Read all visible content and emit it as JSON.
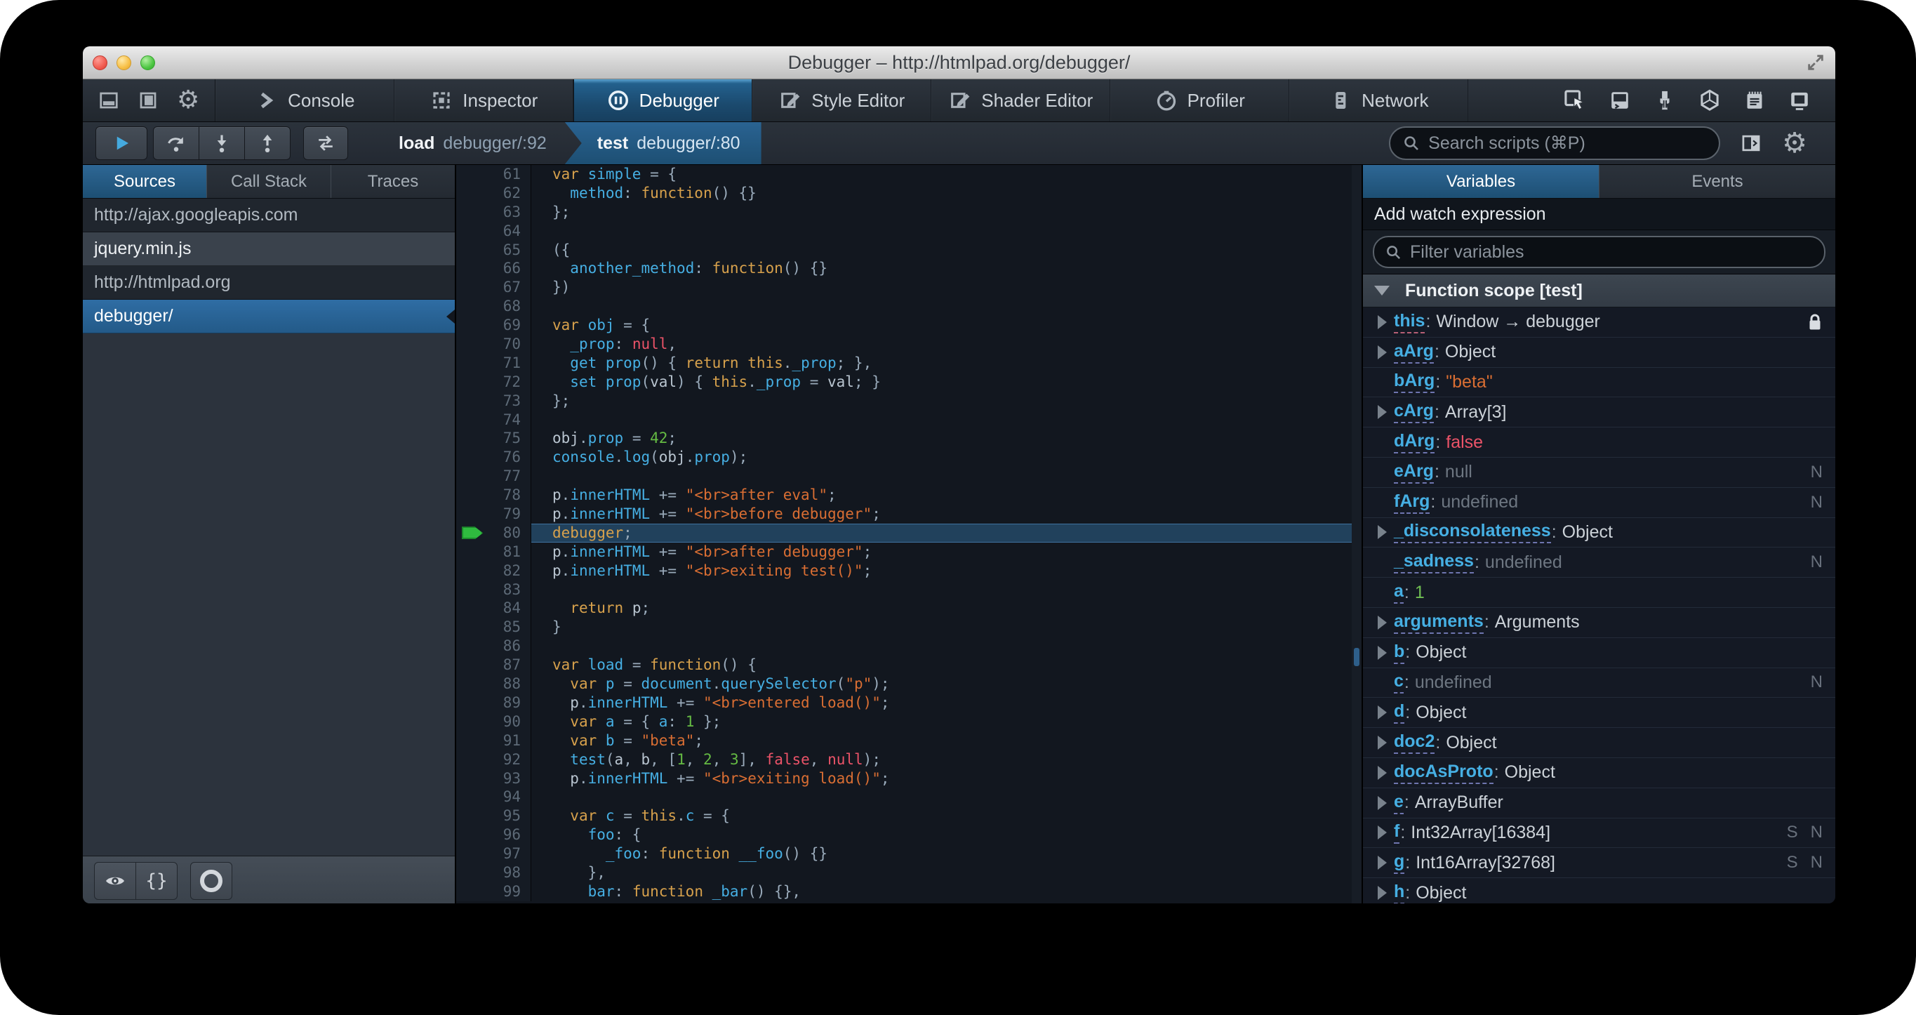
{
  "window": {
    "title": "Debugger – http://htmlpad.org/debugger/"
  },
  "toolbar": {
    "left_icons": [
      "dock-bottom-icon",
      "dock-side-icon",
      "options-gear-icon"
    ],
    "tabs": [
      {
        "label": "Console",
        "icon": "console",
        "active": false
      },
      {
        "label": "Inspector",
        "icon": "inspector",
        "active": false
      },
      {
        "label": "Debugger",
        "icon": "debugger",
        "active": true
      },
      {
        "label": "Style Editor",
        "icon": "style-editor",
        "active": false
      },
      {
        "label": "Shader Editor",
        "icon": "shader-editor",
        "active": false
      },
      {
        "label": "Profiler",
        "icon": "profiler",
        "active": false
      },
      {
        "label": "Network",
        "icon": "network",
        "active": false
      }
    ],
    "right_icons": [
      "pick-element-icon",
      "split-console-icon",
      "paintbrush-icon",
      "tilt-3d-icon",
      "scratchpad-icon",
      "responsive-mode-icon"
    ]
  },
  "debugbar": {
    "buttons": [
      "resume",
      "step-over",
      "step-in",
      "step-out"
    ],
    "trace_button": "trace",
    "breadcrumbs": [
      {
        "fn": "load",
        "loc": "debugger/:92",
        "active": false
      },
      {
        "fn": "test",
        "loc": "debugger/:80",
        "active": true
      }
    ],
    "search_placeholder": "Search scripts (⌘P)",
    "right_icons": [
      "toggle-panel-icon",
      "debugger-options-gear-icon"
    ]
  },
  "sources": {
    "tabs": [
      {
        "label": "Sources",
        "active": true
      },
      {
        "label": "Call Stack",
        "active": false
      },
      {
        "label": "Traces",
        "active": false
      }
    ],
    "items": [
      {
        "kind": "group",
        "label": "http://ajax.googleapis.com"
      },
      {
        "kind": "file",
        "label": "jquery.min.js",
        "selected": false
      },
      {
        "kind": "group",
        "label": "http://htmlpad.org"
      },
      {
        "kind": "file",
        "label": "debugger/",
        "selected": true
      }
    ],
    "footer_buttons": [
      "blackbox-eye",
      "pretty-print",
      "pause-on-exceptions"
    ]
  },
  "editor": {
    "lines": [
      {
        "n": 61,
        "t": [
          [
            "k",
            "var"
          ],
          [
            "o",
            " "
          ],
          [
            "p",
            "simple"
          ],
          [
            "o",
            " = {"
          ]
        ]
      },
      {
        "n": 62,
        "t": [
          [
            "o",
            "  "
          ],
          [
            "p",
            "method"
          ],
          [
            "o",
            ": "
          ],
          [
            "k",
            "function"
          ],
          [
            "o",
            "() {}"
          ]
        ]
      },
      {
        "n": 63,
        "t": [
          [
            "o",
            "};"
          ]
        ]
      },
      {
        "n": 64,
        "t": []
      },
      {
        "n": 65,
        "t": [
          [
            "o",
            "({"
          ]
        ]
      },
      {
        "n": 66,
        "t": [
          [
            "o",
            "  "
          ],
          [
            "p",
            "another_method"
          ],
          [
            "o",
            ": "
          ],
          [
            "k",
            "function"
          ],
          [
            "o",
            "() {}"
          ]
        ]
      },
      {
        "n": 67,
        "t": [
          [
            "o",
            "})"
          ]
        ]
      },
      {
        "n": 68,
        "t": []
      },
      {
        "n": 69,
        "t": [
          [
            "k",
            "var"
          ],
          [
            "o",
            " "
          ],
          [
            "p",
            "obj"
          ],
          [
            "o",
            " = {"
          ]
        ]
      },
      {
        "n": 70,
        "t": [
          [
            "o",
            "  "
          ],
          [
            "p",
            "_prop"
          ],
          [
            "o",
            ": "
          ],
          [
            "a",
            "null"
          ],
          [
            "o",
            ","
          ]
        ]
      },
      {
        "n": 71,
        "t": [
          [
            "o",
            "  "
          ],
          [
            "p",
            "get prop"
          ],
          [
            "o",
            "() { "
          ],
          [
            "k",
            "return"
          ],
          [
            "o",
            " "
          ],
          [
            "k",
            "this"
          ],
          [
            "o",
            "."
          ],
          [
            "p",
            "_prop"
          ],
          [
            "o",
            "; },"
          ]
        ]
      },
      {
        "n": 72,
        "t": [
          [
            "o",
            "  "
          ],
          [
            "p",
            "set prop"
          ],
          [
            "o",
            "("
          ],
          [
            "v",
            "val"
          ],
          [
            "o",
            ") { "
          ],
          [
            "k",
            "this"
          ],
          [
            "o",
            "."
          ],
          [
            "p",
            "_prop"
          ],
          [
            "o",
            " = "
          ],
          [
            "v",
            "val"
          ],
          [
            "o",
            "; }"
          ]
        ]
      },
      {
        "n": 73,
        "t": [
          [
            "o",
            "};"
          ]
        ]
      },
      {
        "n": 74,
        "t": []
      },
      {
        "n": 75,
        "t": [
          [
            "v",
            "obj"
          ],
          [
            "o",
            "."
          ],
          [
            "p",
            "prop"
          ],
          [
            "o",
            " = "
          ],
          [
            "u",
            "42"
          ],
          [
            "o",
            ";"
          ]
        ]
      },
      {
        "n": 76,
        "t": [
          [
            "p",
            "console"
          ],
          [
            "o",
            "."
          ],
          [
            "p",
            "log"
          ],
          [
            "o",
            "("
          ],
          [
            "v",
            "obj"
          ],
          [
            "o",
            "."
          ],
          [
            "p",
            "prop"
          ],
          [
            "o",
            ");"
          ]
        ]
      },
      {
        "n": 77,
        "t": []
      },
      {
        "n": 78,
        "t": [
          [
            "v",
            "p"
          ],
          [
            "o",
            "."
          ],
          [
            "p",
            "innerHTML"
          ],
          [
            "o",
            " += "
          ],
          [
            "s",
            "\"<br>after eval\""
          ],
          [
            "o",
            ";"
          ]
        ]
      },
      {
        "n": 79,
        "t": [
          [
            "v",
            "p"
          ],
          [
            "o",
            "."
          ],
          [
            "p",
            "innerHTML"
          ],
          [
            "o",
            " += "
          ],
          [
            "s",
            "\"<br>before debugger\""
          ],
          [
            "o",
            ";"
          ]
        ]
      },
      {
        "n": 80,
        "t": [
          [
            "k",
            "debugger"
          ],
          [
            "o",
            ";"
          ]
        ],
        "hl": true,
        "arrow": true
      },
      {
        "n": 81,
        "t": [
          [
            "v",
            "p"
          ],
          [
            "o",
            "."
          ],
          [
            "p",
            "innerHTML"
          ],
          [
            "o",
            " += "
          ],
          [
            "s",
            "\"<br>after debugger\""
          ],
          [
            "o",
            ";"
          ]
        ]
      },
      {
        "n": 82,
        "t": [
          [
            "v",
            "p"
          ],
          [
            "o",
            "."
          ],
          [
            "p",
            "innerHTML"
          ],
          [
            "o",
            " += "
          ],
          [
            "s",
            "\"<br>exiting test()\""
          ],
          [
            "o",
            ";"
          ]
        ]
      },
      {
        "n": 83,
        "t": []
      },
      {
        "n": 84,
        "t": [
          [
            "o",
            "  "
          ],
          [
            "k",
            "return"
          ],
          [
            "o",
            " "
          ],
          [
            "v",
            "p"
          ],
          [
            "o",
            ";"
          ]
        ]
      },
      {
        "n": 85,
        "t": [
          [
            "o",
            "}"
          ]
        ]
      },
      {
        "n": 86,
        "t": []
      },
      {
        "n": 87,
        "t": [
          [
            "k",
            "var"
          ],
          [
            "o",
            " "
          ],
          [
            "p",
            "load"
          ],
          [
            "o",
            " = "
          ],
          [
            "k",
            "function"
          ],
          [
            "o",
            "() {"
          ]
        ]
      },
      {
        "n": 88,
        "t": [
          [
            "o",
            "  "
          ],
          [
            "k",
            "var"
          ],
          [
            "o",
            " "
          ],
          [
            "p",
            "p"
          ],
          [
            "o",
            " = "
          ],
          [
            "p",
            "document"
          ],
          [
            "o",
            "."
          ],
          [
            "p",
            "querySelector"
          ],
          [
            "o",
            "("
          ],
          [
            "s",
            "\"p\""
          ],
          [
            "o",
            ");"
          ]
        ]
      },
      {
        "n": 89,
        "t": [
          [
            "o",
            "  "
          ],
          [
            "v",
            "p"
          ],
          [
            "o",
            "."
          ],
          [
            "p",
            "innerHTML"
          ],
          [
            "o",
            " += "
          ],
          [
            "s",
            "\"<br>entered load()\""
          ],
          [
            "o",
            ";"
          ]
        ]
      },
      {
        "n": 90,
        "t": [
          [
            "o",
            "  "
          ],
          [
            "k",
            "var"
          ],
          [
            "o",
            " "
          ],
          [
            "p",
            "a"
          ],
          [
            "o",
            " = { "
          ],
          [
            "p",
            "a"
          ],
          [
            "o",
            ": "
          ],
          [
            "u",
            "1"
          ],
          [
            "o",
            " };"
          ]
        ]
      },
      {
        "n": 91,
        "t": [
          [
            "o",
            "  "
          ],
          [
            "k",
            "var"
          ],
          [
            "o",
            " "
          ],
          [
            "p",
            "b"
          ],
          [
            "o",
            " = "
          ],
          [
            "s",
            "\"beta\""
          ],
          [
            "o",
            ";"
          ]
        ]
      },
      {
        "n": 92,
        "t": [
          [
            "o",
            "  "
          ],
          [
            "p",
            "test"
          ],
          [
            "o",
            "("
          ],
          [
            "v",
            "a"
          ],
          [
            "o",
            ", "
          ],
          [
            "v",
            "b"
          ],
          [
            "o",
            ", ["
          ],
          [
            "u",
            "1"
          ],
          [
            "o",
            ", "
          ],
          [
            "u",
            "2"
          ],
          [
            "o",
            ", "
          ],
          [
            "u",
            "3"
          ],
          [
            "o",
            "], "
          ],
          [
            "a",
            "false"
          ],
          [
            "o",
            ", "
          ],
          [
            "a",
            "null"
          ],
          [
            "o",
            ");"
          ]
        ]
      },
      {
        "n": 93,
        "t": [
          [
            "o",
            "  "
          ],
          [
            "v",
            "p"
          ],
          [
            "o",
            "."
          ],
          [
            "p",
            "innerHTML"
          ],
          [
            "o",
            " += "
          ],
          [
            "s",
            "\"<br>exiting load()\""
          ],
          [
            "o",
            ";"
          ]
        ]
      },
      {
        "n": 94,
        "t": []
      },
      {
        "n": 95,
        "t": [
          [
            "o",
            "  "
          ],
          [
            "k",
            "var"
          ],
          [
            "o",
            " "
          ],
          [
            "p",
            "c"
          ],
          [
            "o",
            " = "
          ],
          [
            "k",
            "this"
          ],
          [
            "o",
            "."
          ],
          [
            "p",
            "c"
          ],
          [
            "o",
            " = {"
          ]
        ]
      },
      {
        "n": 96,
        "t": [
          [
            "o",
            "    "
          ],
          [
            "p",
            "foo"
          ],
          [
            "o",
            ": {"
          ]
        ]
      },
      {
        "n": 97,
        "t": [
          [
            "o",
            "      "
          ],
          [
            "p",
            "_foo"
          ],
          [
            "o",
            ": "
          ],
          [
            "k",
            "function"
          ],
          [
            "o",
            " "
          ],
          [
            "p",
            "__foo"
          ],
          [
            "o",
            "() {}"
          ]
        ]
      },
      {
        "n": 98,
        "t": [
          [
            "o",
            "    },"
          ]
        ]
      },
      {
        "n": 99,
        "t": [
          [
            "o",
            "    "
          ],
          [
            "p",
            "bar"
          ],
          [
            "o",
            ": "
          ],
          [
            "k",
            "function"
          ],
          [
            "o",
            " "
          ],
          [
            "p",
            "_bar"
          ],
          [
            "o",
            "() {},"
          ]
        ]
      }
    ]
  },
  "vars": {
    "tabs": [
      {
        "label": "Variables",
        "active": true
      },
      {
        "label": "Events",
        "active": false
      }
    ],
    "watch_label": "Add watch expression",
    "filter_placeholder": "Filter variables",
    "scope_label": "Function scope [test]",
    "rows": [
      {
        "name": "this",
        "value": "Window → debugger",
        "vt": "plain",
        "exp": true,
        "lock": true,
        "underline": "pink"
      },
      {
        "name": "aArg",
        "value": "Object",
        "vt": "plain",
        "exp": true
      },
      {
        "name": "bArg",
        "value": "\"beta\"",
        "vt": "str",
        "exp": false
      },
      {
        "name": "cArg",
        "value": "Array[3]",
        "vt": "plain",
        "exp": true
      },
      {
        "name": "dArg",
        "value": "false",
        "vt": "atom",
        "exp": false
      },
      {
        "name": "eArg",
        "value": "null",
        "vt": "dim",
        "exp": false,
        "badges": [
          "N"
        ]
      },
      {
        "name": "fArg",
        "value": "undefined",
        "vt": "dim",
        "exp": false,
        "badges": [
          "N"
        ]
      },
      {
        "name": "_disconsolateness",
        "value": "Object",
        "vt": "plain",
        "exp": true
      },
      {
        "name": "_sadness",
        "value": "undefined",
        "vt": "dim",
        "exp": false,
        "badges": [
          "N"
        ]
      },
      {
        "name": "a",
        "value": "1",
        "vt": "num",
        "exp": false
      },
      {
        "name": "arguments",
        "value": "Arguments",
        "vt": "plain",
        "exp": true
      },
      {
        "name": "b",
        "value": "Object",
        "vt": "plain",
        "exp": true
      },
      {
        "name": "c",
        "value": "undefined",
        "vt": "dim",
        "exp": false,
        "badges": [
          "N"
        ]
      },
      {
        "name": "d",
        "value": "Object",
        "vt": "plain",
        "exp": true
      },
      {
        "name": "doc2",
        "value": "Object",
        "vt": "plain",
        "exp": true
      },
      {
        "name": "docAsProto",
        "value": "Object",
        "vt": "plain",
        "exp": true
      },
      {
        "name": "e",
        "value": "ArrayBuffer",
        "vt": "plain",
        "exp": true
      },
      {
        "name": "f",
        "value": "Int32Array[16384]",
        "vt": "plain",
        "exp": true,
        "badges": [
          "S",
          "N"
        ]
      },
      {
        "name": "g",
        "value": "Int16Array[32768]",
        "vt": "plain",
        "exp": true,
        "badges": [
          "S",
          "N"
        ]
      },
      {
        "name": "h",
        "value": "Object",
        "vt": "plain",
        "exp": true
      }
    ]
  },
  "colors": {
    "accent_blue": "#1d4f73",
    "syntax_keyword": "#d7a14c",
    "syntax_identifier": "#46afe3",
    "syntax_string": "#d96e33",
    "syntax_number": "#65bb43",
    "syntax_atom": "#eb5368",
    "debug_arrow_green": "#2fbb3f"
  }
}
